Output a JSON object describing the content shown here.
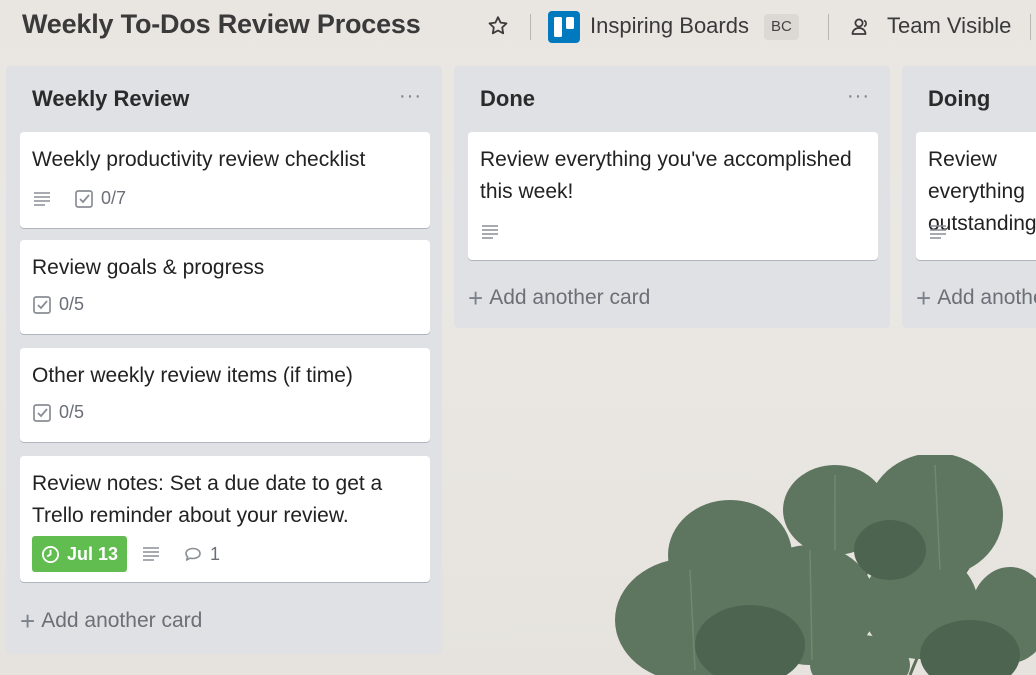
{
  "header": {
    "board_title": "Weekly To-Dos Review Process",
    "workspace_name": "Inspiring Boards",
    "workspace_badge": "BC",
    "visibility_label": "Team Visible"
  },
  "lists": [
    {
      "title": "Weekly Review",
      "menu": "···",
      "cards": [
        {
          "title": "Weekly productivity review checklist",
          "has_description": true,
          "checklist": "0/7"
        },
        {
          "title": "Review goals & progress",
          "checklist": "0/5"
        },
        {
          "title": "Other weekly review items (if time)",
          "checklist": "0/5"
        },
        {
          "title": "Review notes: Set a due date to get a Trello reminder about your review.",
          "due": "Jul 13",
          "has_description": true,
          "comments": "1"
        }
      ],
      "add_card": "Add another card"
    },
    {
      "title": "Done",
      "menu": "···",
      "cards": [
        {
          "title": "Review everything you've accomplished this week!",
          "has_description": true
        }
      ],
      "add_card": "Add another card"
    },
    {
      "title": "Doing",
      "cards": [
        {
          "title": "Review everything outstanding",
          "has_description": true
        }
      ],
      "add_card": "Add another card"
    }
  ],
  "colors": {
    "due_badge": "#61bd4f",
    "workspace_logo": "#0079bf",
    "list_background": "#dfe1e4"
  },
  "icons": {
    "star": "star-icon",
    "workspace": "trello-board-icon",
    "visibility": "team-icon",
    "description": "description-icon",
    "checklist": "checklist-icon",
    "clock": "clock-icon",
    "comment": "comment-icon"
  }
}
